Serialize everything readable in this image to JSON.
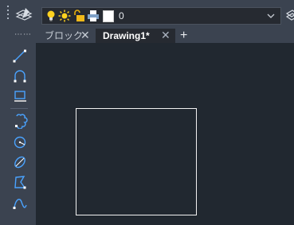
{
  "layer_toolbar": {
    "current_layer_name": "0",
    "current_layer_color": "#ffffff",
    "icons": [
      "layer-properties-manager-icon",
      "layer-on-bulb-icon",
      "layer-thaw-sun-icon",
      "layer-unlock-icon",
      "layer-plot-printer-icon",
      "dropdown-arrow-icon",
      "match-layer-icon"
    ]
  },
  "tabs": {
    "more_label": "⋯⋯",
    "items": [
      {
        "label": "ブロック",
        "close": "✕",
        "active": false
      },
      {
        "label": "Drawing1*",
        "close": "✕",
        "active": true
      }
    ],
    "new_tab_label": "+"
  },
  "draw_tools": [
    "line-icon",
    "arc-icon",
    "rectangle-icon",
    "revision-cloud-icon",
    "circle-icon",
    "ellipse-icon",
    "polygon-icon",
    "spline-icon"
  ],
  "colors": {
    "toolbar_bg": "#3b4350",
    "canvas_bg": "#212830",
    "tool_accent": "#4aa3ff",
    "entity_line": "#f2f2f2",
    "bulb_yellow": "#ffd21f"
  }
}
